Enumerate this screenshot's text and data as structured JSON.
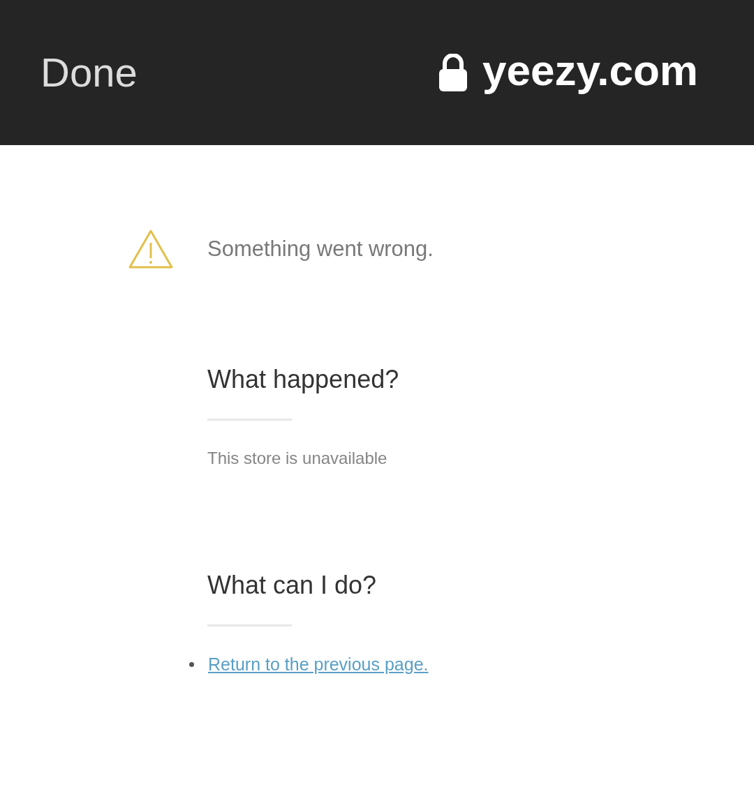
{
  "top_bar": {
    "done_button": "Done",
    "site": {
      "secure": true,
      "domain": "yeezy.com"
    }
  },
  "error": {
    "message": "Something went wrong."
  },
  "sections": [
    {
      "heading": "What happened?",
      "body": "This store is unavailable"
    },
    {
      "heading": "What can I do?",
      "links": [
        "Return to the previous page."
      ]
    }
  ]
}
